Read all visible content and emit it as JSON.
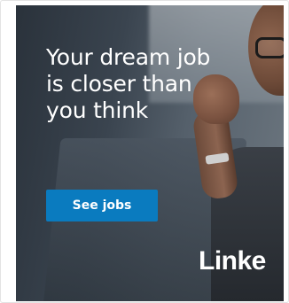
{
  "ad": {
    "headline": "Your dream job is closer than you think",
    "cta_label": "See jobs",
    "brand_text": "Linke",
    "colors": {
      "cta_background": "#0a7bbf",
      "text": "#ffffff"
    }
  }
}
